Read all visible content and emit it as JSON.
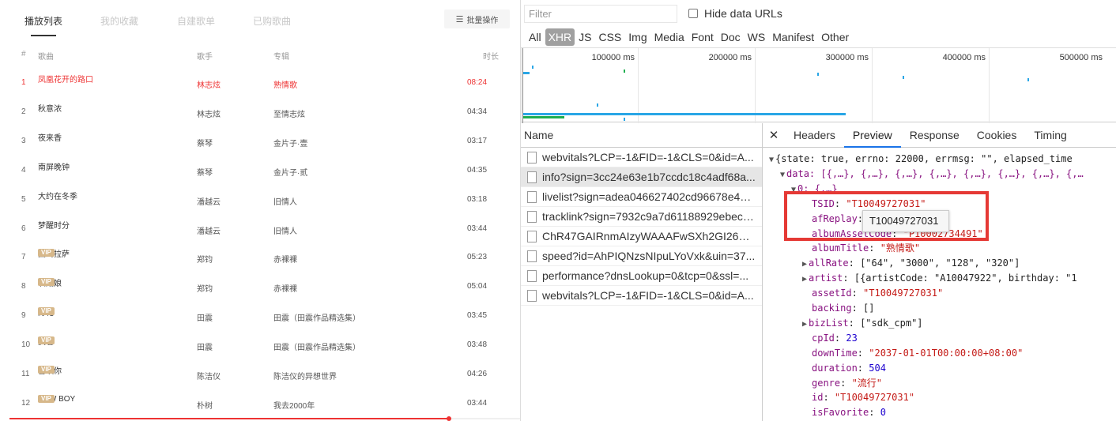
{
  "music": {
    "tabs": [
      {
        "label": "播放列表",
        "active": true
      },
      {
        "label": "我的收藏",
        "active": false
      },
      {
        "label": "自建歌单",
        "active": false
      },
      {
        "label": "已购歌曲",
        "active": false
      }
    ],
    "batch_label": "批量操作",
    "columns": {
      "num": "#",
      "title": "歌曲",
      "artist": "歌手",
      "album": "专辑",
      "duration": "时长"
    },
    "vip_label": "VIP",
    "songs": [
      {
        "num": "1",
        "title": "凤凰花开的路口",
        "artist": "林志炫",
        "album": "熟情歌",
        "duration": "08:24",
        "vip": false,
        "playing": true
      },
      {
        "num": "2",
        "title": "秋意浓",
        "artist": "林志炫",
        "album": "至情志炫",
        "duration": "04:34",
        "vip": false
      },
      {
        "num": "3",
        "title": "夜来香",
        "artist": "蔡琴",
        "album": "金片子·壹",
        "duration": "03:17",
        "vip": false
      },
      {
        "num": "4",
        "title": "南屏晚钟",
        "artist": "蔡琴",
        "album": "金片子·贰",
        "duration": "04:35",
        "vip": false
      },
      {
        "num": "5",
        "title": "大约在冬季",
        "artist": "潘越云",
        "album": "旧情人",
        "duration": "03:18",
        "vip": false
      },
      {
        "num": "6",
        "title": "梦醒时分",
        "artist": "潘越云",
        "album": "旧情人",
        "duration": "03:44",
        "vip": false
      },
      {
        "num": "7",
        "title": "回到拉萨",
        "artist": "郑钧",
        "album": "赤裸裸",
        "duration": "05:23",
        "vip": true
      },
      {
        "num": "8",
        "title": "灰姑娘",
        "artist": "郑钧",
        "album": "赤裸裸",
        "duration": "05:04",
        "vip": true
      },
      {
        "num": "9",
        "title": "野花",
        "artist": "田震",
        "album": "田震（田震作品精选集）",
        "duration": "03:45",
        "vip": true
      },
      {
        "num": "10",
        "title": "执着",
        "artist": "田震",
        "album": "田震（田震作品精选集）",
        "duration": "03:48",
        "vip": true
      },
      {
        "num": "11",
        "title": "喜欢你",
        "artist": "陈洁仪",
        "album": "陈洁仪的异想世界",
        "duration": "04:26",
        "vip": true
      },
      {
        "num": "12",
        "title": "NEW BOY",
        "artist": "朴树",
        "album": "我去2000年",
        "duration": "03:44",
        "vip": true
      }
    ],
    "progress_fraction": 0.86
  },
  "devtools": {
    "filter": {
      "placeholder": "Filter",
      "value": ""
    },
    "hide_data_urls": {
      "label": "Hide data URLs",
      "checked": false
    },
    "type_filters": [
      {
        "label": "All",
        "active": false
      },
      {
        "label": "XHR",
        "active": true
      },
      {
        "label": "JS",
        "active": false
      },
      {
        "label": "CSS",
        "active": false
      },
      {
        "label": "Img",
        "active": false
      },
      {
        "label": "Media",
        "active": false
      },
      {
        "label": "Font",
        "active": false
      },
      {
        "label": "Doc",
        "active": false
      },
      {
        "label": "WS",
        "active": false
      },
      {
        "label": "Manifest",
        "active": false
      },
      {
        "label": "Other",
        "active": false
      }
    ],
    "timeline_ticks": [
      "100000 ms",
      "200000 ms",
      "300000 ms",
      "400000 ms",
      "500000 ms"
    ],
    "name_header": "Name",
    "requests": [
      {
        "name": "webvitals?LCP=-1&FID=-1&CLS=0&id=A...",
        "selected": false
      },
      {
        "name": "info?sign=3cc24e63e1b7ccdc18c4adf68a...",
        "selected": true
      },
      {
        "name": "livelist?sign=adea046627402cd96678e498...",
        "selected": false
      },
      {
        "name": "tracklink?sign=7932c9a7d61188929ebecc...",
        "selected": false
      },
      {
        "name": "ChR47GAIRnmAIzyWAAAFwSXh2GI263.lrc",
        "selected": false
      },
      {
        "name": "speed?id=AhPIQNzsNIpuLYoVxk&uin=37...",
        "selected": false
      },
      {
        "name": "performance?dnsLookup=0&tcp=0&ssl=...",
        "selected": false
      },
      {
        "name": "webvitals?LCP=-1&FID=-1&CLS=0&id=A...",
        "selected": false
      }
    ],
    "detail_tabs": [
      {
        "label": "Headers",
        "active": false
      },
      {
        "label": "Preview",
        "active": true
      },
      {
        "label": "Response",
        "active": false
      },
      {
        "label": "Cookies",
        "active": false
      },
      {
        "label": "Timing",
        "active": false
      }
    ],
    "tooltip": "T10049727031",
    "preview": {
      "root_line": "{state: true, errno: 22000, errmsg: \"\", elapsed_time",
      "data_line": "data: [{,…}, {,…}, {,…}, {,…}, {,…}, {,…}, {,…}, {,…",
      "item_line": "0: {,…}",
      "fields": [
        {
          "key": "TSID",
          "value": "\"T10049727031\"",
          "kind": "s"
        },
        {
          "key": "afReplay",
          "value": "",
          "kind": "s"
        },
        {
          "key": "albumAssetCode",
          "value": "\"P10002734491\"",
          "kind": "s"
        },
        {
          "key": "albumTitle",
          "value": "\"熟情歌\"",
          "kind": "s"
        },
        {
          "key": "allRate",
          "value": "[\"64\", \"3000\", \"128\", \"320\"]",
          "kind": "p",
          "expandable": true
        },
        {
          "key": "artist",
          "value": "[{artistCode: \"A10047922\", birthday: \"1",
          "kind": "p",
          "expandable": true
        },
        {
          "key": "assetId",
          "value": "\"T10049727031\"",
          "kind": "s"
        },
        {
          "key": "backing",
          "value": "[]",
          "kind": "p"
        },
        {
          "key": "bizList",
          "value": "[\"sdk_cpm\"]",
          "kind": "p",
          "expandable": true
        },
        {
          "key": "cpId",
          "value": "23",
          "kind": "n"
        },
        {
          "key": "downTime",
          "value": "\"2037-01-01T00:00:00+08:00\"",
          "kind": "s"
        },
        {
          "key": "duration",
          "value": "504",
          "kind": "n"
        },
        {
          "key": "genre",
          "value": "\"流行\"",
          "kind": "s"
        },
        {
          "key": "id",
          "value": "\"T10049727031\"",
          "kind": "s"
        },
        {
          "key": "isFavorite",
          "value": "0",
          "kind": "n"
        }
      ]
    }
  },
  "colors": {
    "accent_red": "#e33",
    "vip_gold": "#d7b88a",
    "active_tab_blue": "#1a73e8",
    "highlight_red": "#e53935"
  }
}
